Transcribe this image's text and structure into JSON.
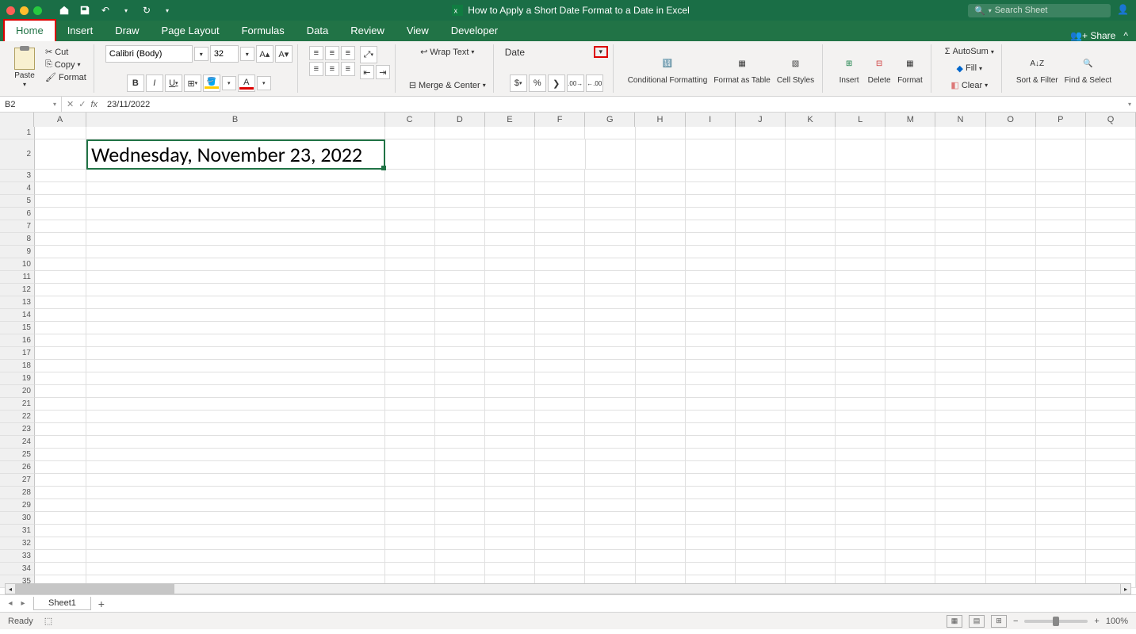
{
  "titlebar": {
    "doc_title": "How to Apply a Short Date Format to a Date in Excel",
    "search_placeholder": "Search Sheet"
  },
  "tabs": {
    "items": [
      "Home",
      "Insert",
      "Draw",
      "Page Layout",
      "Formulas",
      "Data",
      "Review",
      "View",
      "Developer"
    ],
    "share": "Share"
  },
  "ribbon": {
    "paste": "Paste",
    "cut": "Cut",
    "copy": "Copy",
    "format_painter": "Format",
    "font_name": "Calibri (Body)",
    "font_size": "32",
    "bold": "B",
    "italic": "I",
    "underline": "U",
    "wrap": "Wrap Text",
    "merge": "Merge & Center",
    "number_format": "Date",
    "cond_fmt": "Conditional Formatting",
    "fmt_table": "Format as Table",
    "cell_styles": "Cell Styles",
    "insert": "Insert",
    "delete": "Delete",
    "format": "Format",
    "autosum": "AutoSum",
    "fill": "Fill",
    "clear": "Clear",
    "sort": "Sort & Filter",
    "find": "Find & Select"
  },
  "formula_bar": {
    "name_box": "B2",
    "formula": "23/11/2022"
  },
  "columns": [
    "A",
    "B",
    "C",
    "D",
    "E",
    "F",
    "G",
    "H",
    "I",
    "J",
    "K",
    "L",
    "M",
    "N",
    "O",
    "P",
    "Q"
  ],
  "rows": 35,
  "cell_b2": "Wednesday, November 23, 2022",
  "sheet_tabs": {
    "active": "Sheet1"
  },
  "status": {
    "ready": "Ready",
    "zoom": "100%"
  }
}
